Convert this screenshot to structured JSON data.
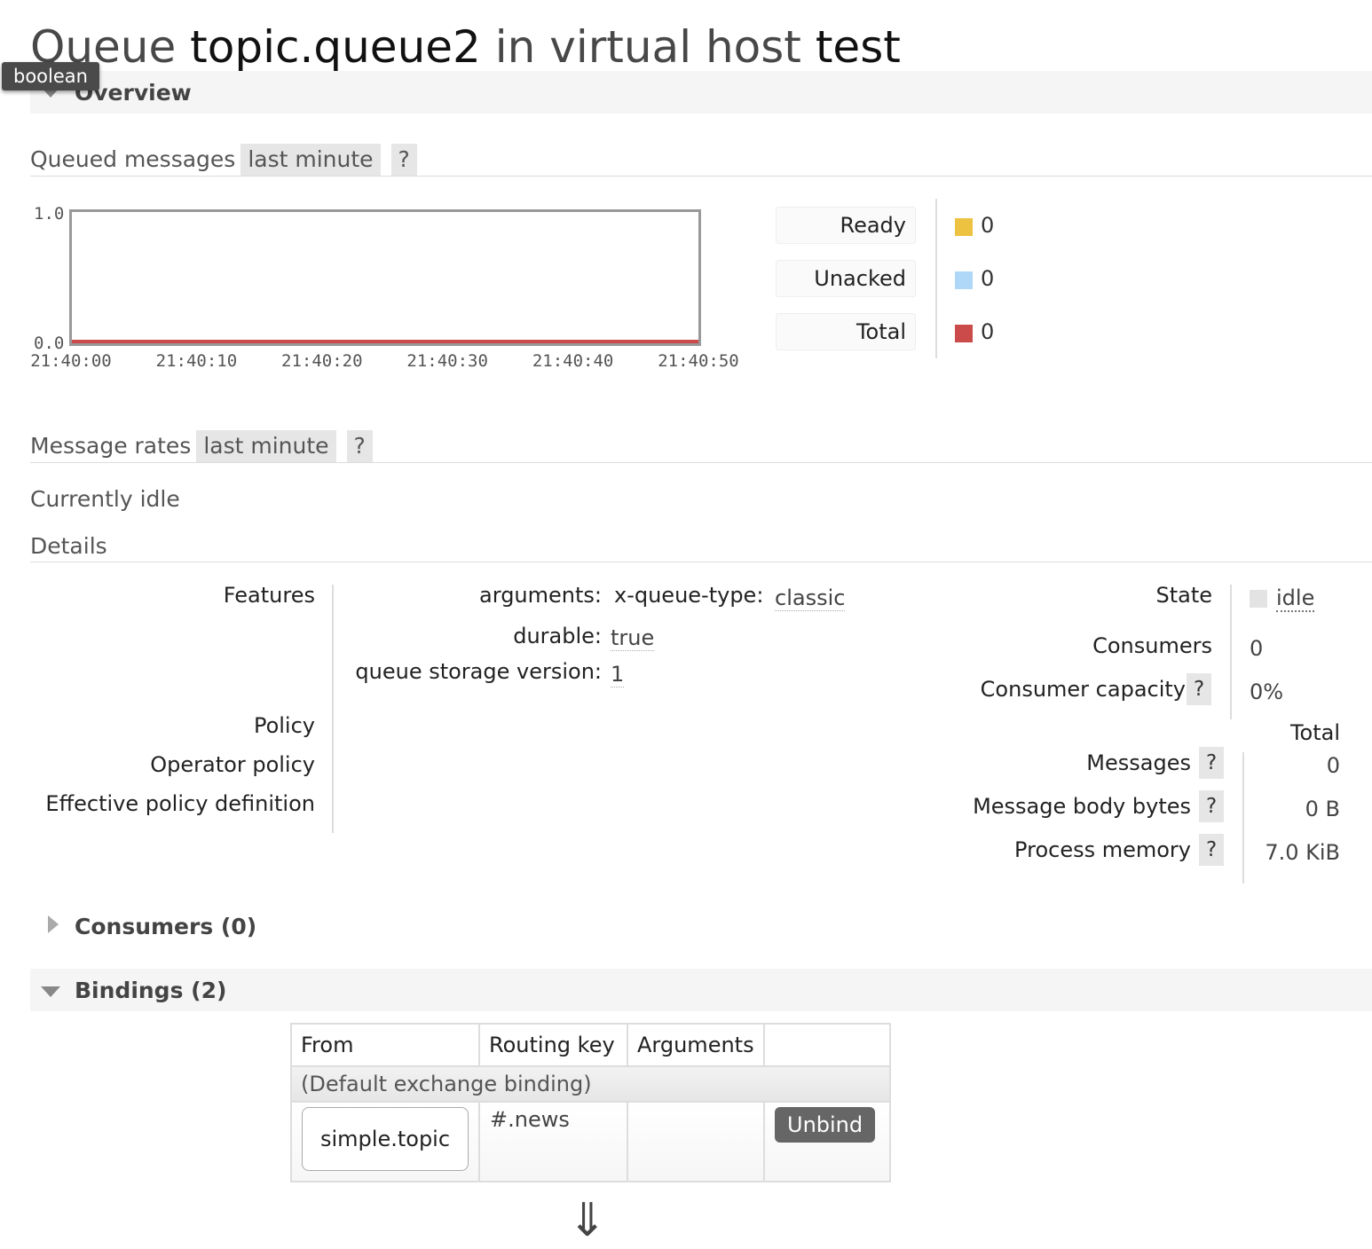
{
  "title": {
    "prefix": "Queue",
    "queue": "topic.queue2",
    "middle": "in virtual host",
    "vhost": "test"
  },
  "tooltip": "boolean",
  "overview": {
    "label": "Overview"
  },
  "queued": {
    "title": "Queued messages",
    "range": "last minute",
    "help": "?",
    "y_top": "1.0",
    "y_bottom": "0.0",
    "x_ticks": [
      "21:40:00",
      "21:40:10",
      "21:40:20",
      "21:40:30",
      "21:40:40",
      "21:40:50"
    ],
    "legend": [
      {
        "label": "Ready",
        "value": "0",
        "color": "#edc240"
      },
      {
        "label": "Unacked",
        "value": "0",
        "color": "#afd8f8"
      },
      {
        "label": "Total",
        "value": "0",
        "color": "#cb4b4b"
      }
    ]
  },
  "chart_data": {
    "type": "line",
    "x": [
      "21:40:00",
      "21:40:10",
      "21:40:20",
      "21:40:30",
      "21:40:40",
      "21:40:50"
    ],
    "ylim": [
      0,
      1
    ],
    "series": [
      {
        "name": "Ready",
        "values": [
          0,
          0,
          0,
          0,
          0,
          0
        ],
        "color": "#edc240"
      },
      {
        "name": "Unacked",
        "values": [
          0,
          0,
          0,
          0,
          0,
          0
        ],
        "color": "#afd8f8"
      },
      {
        "name": "Total",
        "values": [
          0,
          0,
          0,
          0,
          0,
          0
        ],
        "color": "#cb4b4b"
      }
    ]
  },
  "rates": {
    "title": "Message rates",
    "range": "last minute",
    "help": "?",
    "status": "Currently idle"
  },
  "details": {
    "title": "Details",
    "features_label": "Features",
    "arguments_key": "arguments:",
    "x_queue_type_key": "x-queue-type:",
    "x_queue_type_val": "classic",
    "durable_key": "durable:",
    "durable_val": "true",
    "storage_key": "queue storage version:",
    "storage_val": "1",
    "policy_label": "Policy",
    "operator_policy_label": "Operator policy",
    "effective_policy_label": "Effective policy definition",
    "state_label": "State",
    "state_val": "idle",
    "consumers_label": "Consumers",
    "consumers_val": "0",
    "capacity_label": "Consumer capacity",
    "capacity_val": "0%",
    "help": "?",
    "total_header": "Total",
    "messages_label": "Messages",
    "messages_val": "0",
    "body_bytes_label": "Message body bytes",
    "body_bytes_val": "0 B",
    "memory_label": "Process memory",
    "memory_val": "7.0 KiB"
  },
  "consumers_section": {
    "label": "Consumers (0)"
  },
  "bindings_section": {
    "label": "Bindings (2)",
    "headers": [
      "From",
      "Routing key",
      "Arguments",
      ""
    ],
    "default_binding": "(Default exchange binding)",
    "rows": [
      {
        "from": "simple.topic",
        "routing_key": "#.news",
        "arguments": "",
        "action": "Unbind"
      }
    ],
    "arrow": "⇓"
  }
}
